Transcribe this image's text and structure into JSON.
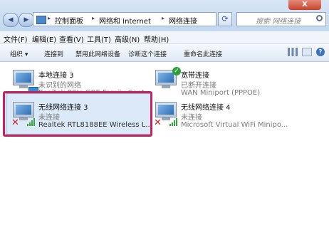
{
  "window": {
    "close_label": "X"
  },
  "address_bar": {
    "crumbs": [
      "控制面板",
      "网络和 Internet",
      "网络连接"
    ]
  },
  "search": {
    "placeholder": "搜索 网络连接"
  },
  "menu": [
    "文件(F)",
    "编辑(E)",
    "查看(V)",
    "工具(T)",
    "高级(N)",
    "帮助(H)"
  ],
  "toolbar": {
    "organize": "组织 ▾",
    "connect_to": "连接到",
    "disable_device": "禁用此网络设备",
    "diagnose": "诊断这个连接",
    "rename": "重命名此连接"
  },
  "connections": [
    {
      "name": "本地连接 3",
      "status": "未识别的网络",
      "device": "Realtek PCIe GBE Family Cont..."
    },
    {
      "name": "宽带连接",
      "status": "已断开连接",
      "device": "WAN Miniport (PPPOE)"
    },
    {
      "name": "无线网络连接 3",
      "status": "未连接",
      "device": "Realtek RTL8188EE Wireless L..."
    },
    {
      "name": "无线网络连接 4",
      "status": "未连接",
      "device": "Microsoft Virtual WiFi Minipo..."
    }
  ],
  "colors": {
    "highlight_frame": "#c3245b",
    "selected_bg": "#dbe9f8",
    "signal_green": "#2fa83a",
    "error_red": "#d21f1f"
  }
}
